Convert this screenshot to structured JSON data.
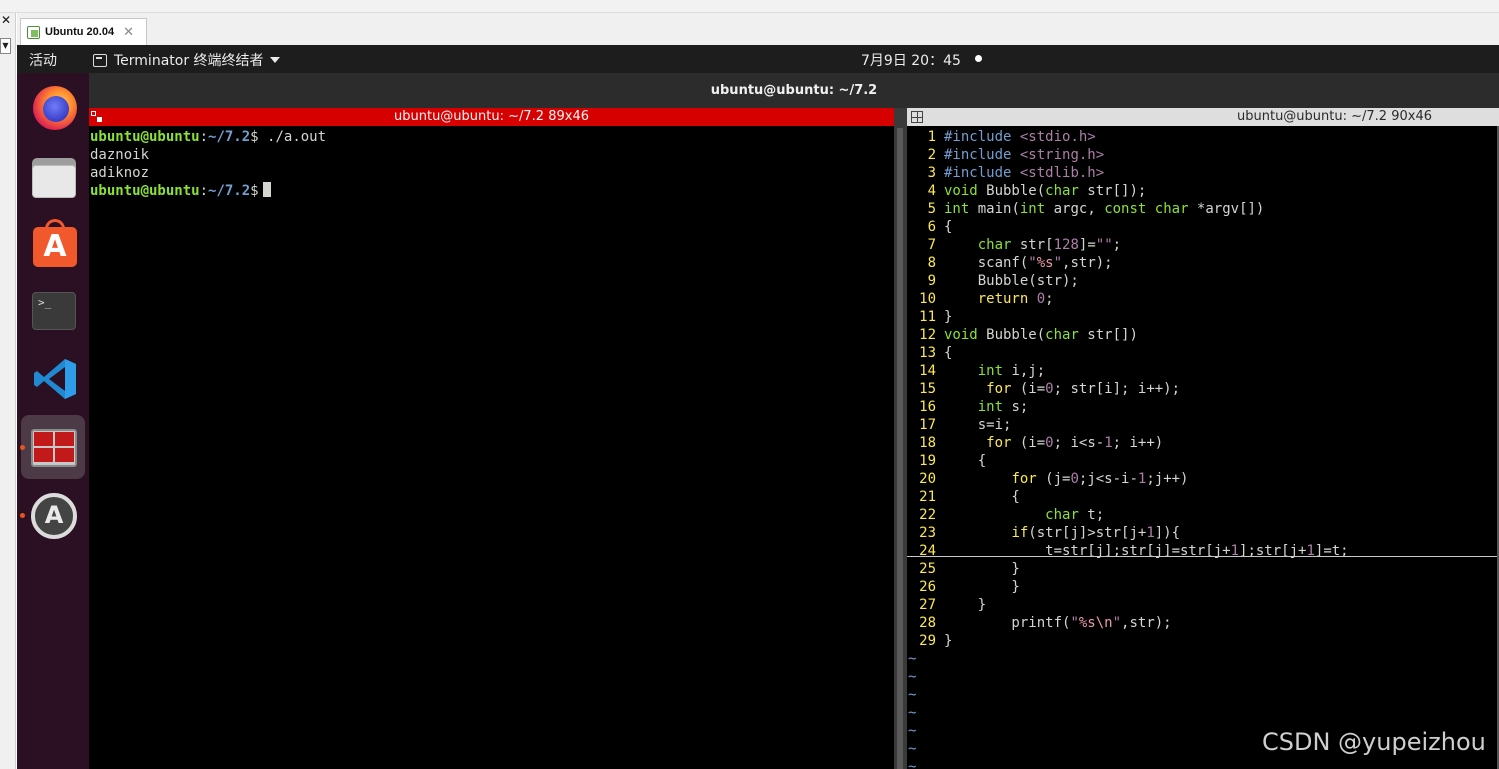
{
  "host": {
    "tab_label": "Ubuntu 20.04",
    "close_glyph": "✕",
    "side_close_glyph": "✕",
    "side_dropdown_glyph": "▼"
  },
  "topbar": {
    "activities": "活动",
    "app_name": "Terminator 终端终结者",
    "clock": "7月9日  20：45"
  },
  "dock": {
    "items": [
      "firefox-icon",
      "files-icon",
      "ubuntu-software-icon",
      "terminal-icon",
      "vscode-icon",
      "terminator-icon",
      "software-updater-icon"
    ],
    "active": "terminator-icon",
    "running_color": "#e9541e"
  },
  "window": {
    "title": "ubuntu@ubuntu: ~/7.2"
  },
  "left_pane": {
    "title": "ubuntu@ubuntu: ~/7.2 89x46",
    "title_bg": "#d70000",
    "lines": [
      {
        "user": "ubuntu@ubuntu",
        "sep": ":",
        "path": "~/7.2",
        "cmd": "$ ./a.out"
      },
      {
        "text": "daznoik"
      },
      {
        "text": "adiknoz"
      },
      {
        "user": "ubuntu@ubuntu",
        "sep": ":",
        "path": "~/7.2",
        "cmd": "$"
      }
    ]
  },
  "right_pane": {
    "title": "ubuntu@ubuntu: ~/7.2 90x46",
    "line_numbers": [
      "1",
      "2",
      "3",
      "4",
      "5",
      "6",
      "7",
      "8",
      "9",
      "10",
      "11",
      "12",
      "13",
      "14",
      "15",
      "16",
      "17",
      "18",
      "19",
      "20",
      "21",
      "22",
      "23",
      "24",
      "25",
      "26",
      "27",
      "28",
      "29"
    ],
    "code": [
      "#include <stdio.h>",
      "#include <string.h>",
      "#include <stdlib.h>",
      "void Bubble(char str[]);",
      "int main(int argc, const char *argv[])",
      "{",
      "    char str[128]=\"\";",
      "    scanf(\"%s\",str);",
      "    Bubble(str);",
      "    return 0;",
      "}",
      "void Bubble(char str[])",
      "{",
      "    int i,j;",
      "     for (i=0; str[i]; i++);",
      "    int s;",
      "    s=i;",
      "     for (i=0; i<s-1; i++)",
      "    {",
      "        for (j=0;j<s-i-1;j++)",
      "        {",
      "            char t;",
      "        if(str[j]>str[j+1]){",
      "            t=str[j];str[j]=str[j+1];str[j+1]=t;",
      "        }",
      "        }",
      "    }",
      "        printf(\"%s\\n\",str);",
      "}"
    ],
    "tilde_rows": [
      "~",
      "~",
      "~",
      "~",
      "~",
      "~",
      "~"
    ]
  },
  "watermark": "CSDN @yupeizhou"
}
